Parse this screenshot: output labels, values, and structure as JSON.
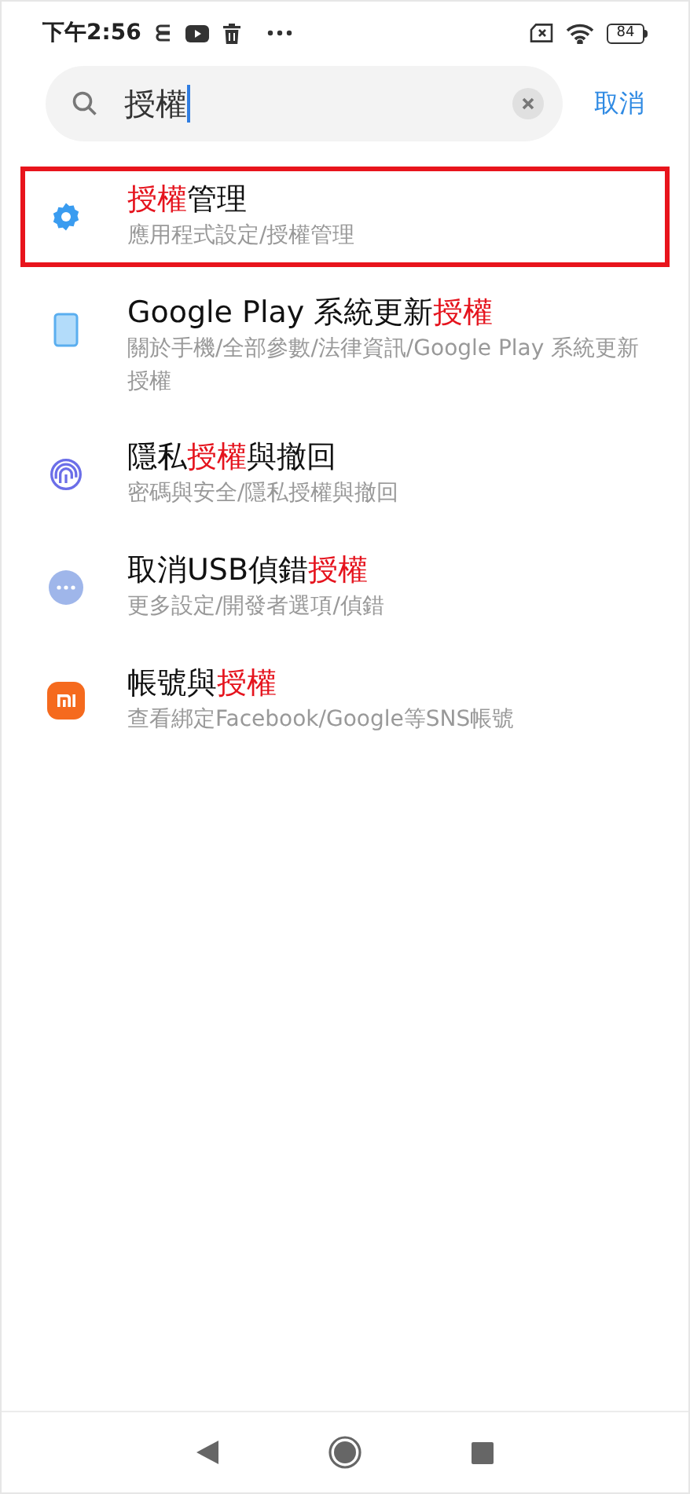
{
  "status_bar": {
    "time": "下午2:56",
    "battery": "84"
  },
  "search": {
    "value": "授權",
    "cancel": "取消"
  },
  "results": [
    {
      "kind": "gear",
      "outlined": true,
      "title": [
        {
          "text": "授權",
          "match": true
        },
        {
          "text": "管理",
          "match": false
        }
      ],
      "path": "應用程式設定/授權管理"
    },
    {
      "kind": "phone",
      "outlined": false,
      "title": [
        {
          "text": "Google Play 系統更新",
          "match": false
        },
        {
          "text": "授權",
          "match": true
        }
      ],
      "path": "關於手機/全部參數/法律資訊/Google Play 系統更新授權"
    },
    {
      "kind": "fingerprint",
      "outlined": false,
      "title": [
        {
          "text": "隱私",
          "match": false
        },
        {
          "text": "授權",
          "match": true
        },
        {
          "text": "與撤回",
          "match": false
        }
      ],
      "path": "密碼與安全/隱私授權與撤回"
    },
    {
      "kind": "more",
      "outlined": false,
      "title": [
        {
          "text": "取消USB偵錯",
          "match": false
        },
        {
          "text": "授權",
          "match": true
        }
      ],
      "path": "更多設定/開發者選項/偵錯"
    },
    {
      "kind": "mi",
      "outlined": false,
      "title": [
        {
          "text": "帳號與",
          "match": false
        },
        {
          "text": "授權",
          "match": true
        }
      ],
      "path": "查看綁定Facebook/Google等SNS帳號"
    }
  ]
}
